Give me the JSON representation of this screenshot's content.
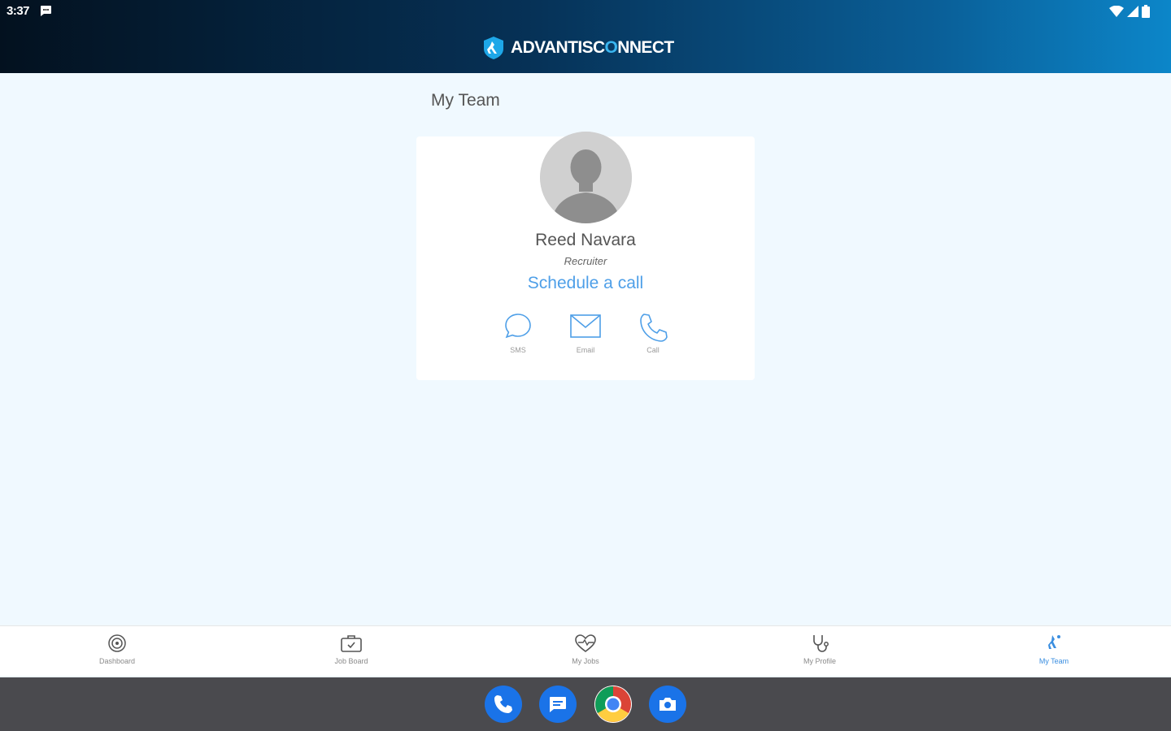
{
  "status_bar": {
    "time": "3:37"
  },
  "header": {
    "brand_main": "ADVANTISC",
    "brand_accent": "O",
    "brand_tail": "NNECT"
  },
  "main": {
    "title": "My Team",
    "member": {
      "name": "Reed Navara",
      "role": "Recruiter",
      "schedule_label": "Schedule a call",
      "actions": [
        {
          "label": "SMS",
          "icon": "chat-bubble-icon"
        },
        {
          "label": "Email",
          "icon": "envelope-icon"
        },
        {
          "label": "Call",
          "icon": "phone-icon"
        }
      ]
    }
  },
  "bottom_nav": {
    "items": [
      {
        "label": "Dashboard",
        "icon": "dashboard-icon",
        "active": false
      },
      {
        "label": "Job Board",
        "icon": "briefcase-icon",
        "active": false
      },
      {
        "label": "My Jobs",
        "icon": "heart-pulse-icon",
        "active": false
      },
      {
        "label": "My Profile",
        "icon": "stethoscope-icon",
        "active": false
      },
      {
        "label": "My Team",
        "icon": "team-icon",
        "active": true
      }
    ]
  },
  "dock": {
    "apps": [
      {
        "name": "Phone",
        "icon": "phone-app-icon",
        "color": "#1a73e8"
      },
      {
        "name": "Messages",
        "icon": "messages-app-icon",
        "color": "#1a73e8"
      },
      {
        "name": "Chrome",
        "icon": "chrome-app-icon",
        "color": "#ffffff"
      },
      {
        "name": "Camera",
        "icon": "camera-app-icon",
        "color": "#1a73e8"
      }
    ]
  },
  "colors": {
    "accent": "#4e9fe8",
    "active_nav": "#3a8ee0",
    "background": "#f0f9ff"
  }
}
